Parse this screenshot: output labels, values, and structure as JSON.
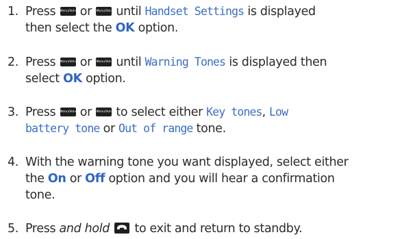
{
  "keys": {
    "up": "Menu/Vol+",
    "down": "Menu/Vol-"
  },
  "steps": [
    {
      "number": "1.",
      "t1": "Press",
      "t2": "or",
      "t3": "until",
      "screen": "Handset Settings",
      "t4": "is displayed",
      "t5": "then select the",
      "option": "OK",
      "t6": "option."
    },
    {
      "number": "2.",
      "t1": "Press",
      "t2": "or",
      "t3": "until",
      "screen": "Warning Tones",
      "t4": "is displayed then",
      "t5": "select",
      "option": "OK",
      "t6": "option."
    },
    {
      "number": "3.",
      "t1": "Press",
      "t2": "or",
      "t3": "to select either",
      "screen1": "Key tones",
      "sep": ",",
      "screen2a": "Low",
      "screen2b": "battery tone",
      "t4": "or",
      "screen3": "Out of range",
      "t5": "tone."
    },
    {
      "number": "4.",
      "line1": "With the warning tone you want displayed, select either",
      "t1": "the",
      "option1": "On",
      "t2": "or",
      "option2": "Off",
      "t3": "option and you will hear a confirmation",
      "line3": "tone."
    },
    {
      "number": "5.",
      "t1": "Press",
      "emph": "and hold",
      "t2": "to exit and return to standby."
    }
  ],
  "icons": {
    "end_call": "end-call-icon",
    "menu_key": "menu-vol-key-icon"
  },
  "colors": {
    "screen_text": "#3b6fc2",
    "option_text": "#2f64c0",
    "body_text": "#2b2b2b",
    "key_fill": "#1f1f1f"
  }
}
